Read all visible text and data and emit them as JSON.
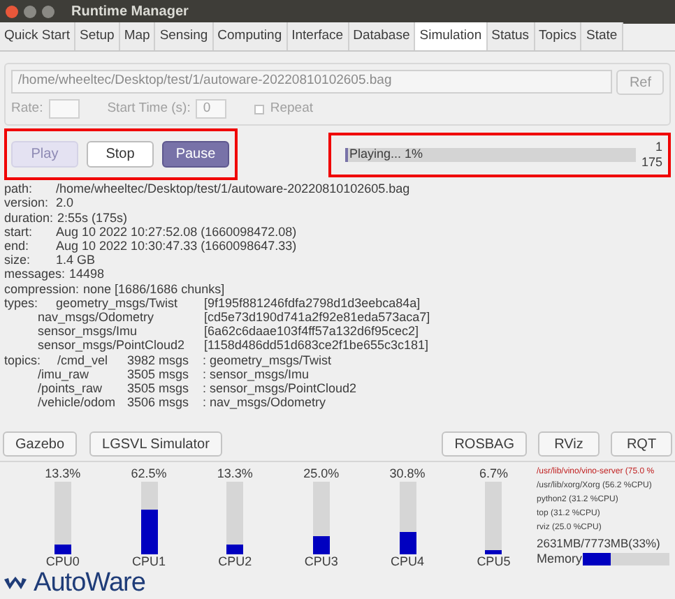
{
  "window": {
    "title": "Runtime Manager"
  },
  "tabs": [
    {
      "label": "Quick Start",
      "selected": false
    },
    {
      "label": "Setup",
      "selected": false
    },
    {
      "label": "Map",
      "selected": false
    },
    {
      "label": "Sensing",
      "selected": false
    },
    {
      "label": "Computing",
      "selected": false
    },
    {
      "label": "Interface",
      "selected": false
    },
    {
      "label": "Database",
      "selected": false
    },
    {
      "label": "Simulation",
      "selected": true
    },
    {
      "label": "Status",
      "selected": false
    },
    {
      "label": "Topics",
      "selected": false
    },
    {
      "label": "State",
      "selected": false
    }
  ],
  "bag": {
    "path": "/home/wheeltec/Desktop/test/1/autoware-20220810102605.bag",
    "ref_button": "Ref",
    "rate_label": "Rate:",
    "start_time_label": "Start Time (s):",
    "start_time_value": "0",
    "repeat_label": "Repeat",
    "repeat_checked": false
  },
  "controls": {
    "highlighted": true,
    "buttons": [
      {
        "label": "Play",
        "disabled": true,
        "active": false
      },
      {
        "label": "Stop",
        "disabled": false,
        "active": false
      },
      {
        "label": "Pause",
        "disabled": false,
        "active": true
      }
    ]
  },
  "progress": {
    "highlighted": true,
    "text": "Playing... 1%",
    "level": 0.01,
    "current": "1",
    "total": "175"
  },
  "info": [
    {
      "label": "path:",
      "value": "/home/wheeltec/Desktop/test/1/autoware-20220810102605.bag"
    },
    {
      "label": "version:",
      "value": "2.0"
    },
    {
      "label": "duration:",
      "value": "2:55s (175s)"
    },
    {
      "label": "start:",
      "value": "Aug 10 2022 10:27:52.08 (1660098472.08)"
    },
    {
      "label": "end:",
      "value": "Aug 10 2022 10:30:47.33 (1660098647.33)"
    },
    {
      "label": "size:",
      "value": "1.4 GB"
    },
    {
      "label": "messages:",
      "value": "14498"
    },
    {
      "label": "compression:",
      "value": "none [1686/1686 chunks]"
    }
  ],
  "types_label": "types:",
  "types": [
    {
      "name": "geometry_msgs/Twist",
      "hash": "[9f195f881246fdfa2798d1d3eebca84a]"
    },
    {
      "name": "nav_msgs/Odometry",
      "hash": "[cd5e73d190d741a2f92e81eda573aca7]"
    },
    {
      "name": "sensor_msgs/Imu",
      "hash": "[6a62c6daae103f4ff57a132d6f95cec2]"
    },
    {
      "name": "sensor_msgs/PointCloud2",
      "hash": "[1158d486dd51d683ce2f1be655c3c181]"
    }
  ],
  "topics_label": "topics:",
  "topics": [
    {
      "topic": "/cmd_vel",
      "count": "3982 msgs",
      "type": ": geometry_msgs/Twist"
    },
    {
      "topic": "/imu_raw",
      "count": "3505 msgs",
      "type": ": sensor_msgs/Imu"
    },
    {
      "topic": "/points_raw",
      "count": "3505 msgs",
      "type": ": sensor_msgs/PointCloud2"
    },
    {
      "topic": "/vehicle/odom",
      "count": "3506 msgs",
      "type": ": nav_msgs/Odometry"
    }
  ],
  "left_buttons": [
    "Gazebo",
    "LGSVL Simulator"
  ],
  "right_buttons": [
    "ROSBAG",
    "RViz",
    "RQT"
  ],
  "cpus": [
    {
      "label": "CPU0",
      "percent": "13.3%",
      "level": 0.133
    },
    {
      "label": "CPU1",
      "percent": "62.5%",
      "level": 0.625
    },
    {
      "label": "CPU2",
      "percent": "13.3%",
      "level": 0.133
    },
    {
      "label": "CPU3",
      "percent": "25.0%",
      "level": 0.25
    },
    {
      "label": "CPU4",
      "percent": "30.8%",
      "level": 0.308
    },
    {
      "label": "CPU5",
      "percent": "6.7%",
      "level": 0.067
    }
  ],
  "processes": [
    {
      "text": "/usr/lib/vino/vino-server (75.0 %",
      "alert": true
    },
    {
      "text": "/usr/lib/xorg/Xorg (56.2 %CPU)",
      "alert": false
    },
    {
      "text": "python2 (31.2 %CPU)",
      "alert": false
    },
    {
      "text": "top (31.2 %CPU)",
      "alert": false
    },
    {
      "text": "rviz (25.0 %CPU)",
      "alert": false
    }
  ],
  "memory": {
    "usage": "2631MB/7773MB(33%)",
    "label": "Memory",
    "level": 0.33
  },
  "logo": {
    "text": "AutoWare"
  }
}
